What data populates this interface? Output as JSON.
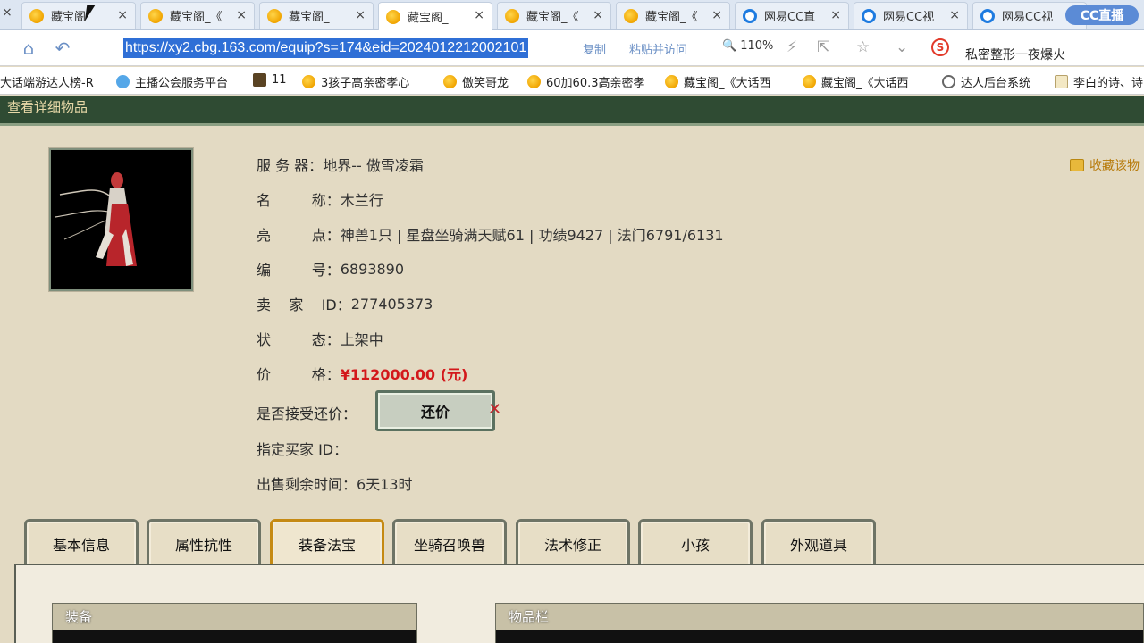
{
  "browser": {
    "tabs": [
      {
        "label": "藏宝阁",
        "icon": "cbg",
        "active": false
      },
      {
        "label": "藏宝阁_《",
        "icon": "cbg",
        "active": false
      },
      {
        "label": "藏宝阁_",
        "icon": "cbg",
        "active": false
      },
      {
        "label": "藏宝阁_",
        "icon": "cbg",
        "active": true
      },
      {
        "label": "藏宝阁_《",
        "icon": "cbg",
        "active": false
      },
      {
        "label": "藏宝阁_《",
        "icon": "cbg",
        "active": false
      },
      {
        "label": "网易CC直",
        "icon": "cc",
        "active": false
      },
      {
        "label": "网易CC视",
        "icon": "cc",
        "active": false
      },
      {
        "label": "网易CC视",
        "icon": "cc",
        "active": false
      }
    ],
    "close_glyph": "×",
    "cc_logo": "CC直播",
    "url": "https://xy2.cbg.163.com/equip?s=174&eid=2024012212002101",
    "copy_label": "复制",
    "paste_go_label": "粘贴并访问",
    "zoom": "110%",
    "search_engine": "S",
    "search_text": "私密整形一夜爆火",
    "bookmarks": [
      {
        "label": "大话端游达人榜-R",
        "icon": "none"
      },
      {
        "label": "主播公会服务平台",
        "icon": "blue"
      },
      {
        "label": "11",
        "icon": "dark"
      },
      {
        "label": "3孩子高亲密孝心",
        "icon": "cbg"
      },
      {
        "label": "傲笑哥龙",
        "icon": "cbg"
      },
      {
        "label": "60加60.3高亲密孝",
        "icon": "cbg"
      },
      {
        "label": "藏宝阁_《大话西",
        "icon": "cbg"
      },
      {
        "label": "藏宝阁_《大话西",
        "icon": "cbg"
      },
      {
        "label": "达人后台系统",
        "icon": "globe"
      },
      {
        "label": "李白的诗、诗",
        "icon": "ji"
      }
    ]
  },
  "page": {
    "header_title": "查看详细物品",
    "favorite_label": "收藏该物",
    "details": [
      {
        "label": "服 务 器：",
        "value": "地界-- 傲雪凌霜"
      },
      {
        "label": "名         称：",
        "value": "木兰行"
      },
      {
        "label": "亮         点：",
        "value": "神兽1只 | 星盘坐骑满天赋61 | 功绩9427 | 法门6791/6131"
      },
      {
        "label": "编         号：",
        "value": "6893890"
      },
      {
        "label": "卖    家    ID：",
        "value": "277405373"
      },
      {
        "label": "状         态：",
        "value": "上架中"
      },
      {
        "label": "价         格：",
        "value": "¥112000.00 (元)"
      },
      {
        "label": "是否接受还价：",
        "value": ""
      },
      {
        "label": "指定买家 ID：",
        "value": ""
      },
      {
        "label": "出售剩余时间：",
        "value": "6天13时"
      }
    ],
    "bargain_label": "还价",
    "tabs": [
      {
        "label": "基本信息",
        "active": false
      },
      {
        "label": "属性抗性",
        "active": false
      },
      {
        "label": "装备法宝",
        "active": true
      },
      {
        "label": "坐骑召唤兽",
        "active": false
      },
      {
        "label": "法术修正",
        "active": false
      },
      {
        "label": "小孩",
        "active": false
      },
      {
        "label": "外观道具",
        "active": false
      }
    ],
    "equipment_panel_title": "装备",
    "inventory_panel_title": "物品栏"
  },
  "colors": {
    "price": "#d3181b",
    "header_bg": "#2f4b33",
    "page_bg": "#e3dac3",
    "active_tab_border": "#c58a14"
  }
}
